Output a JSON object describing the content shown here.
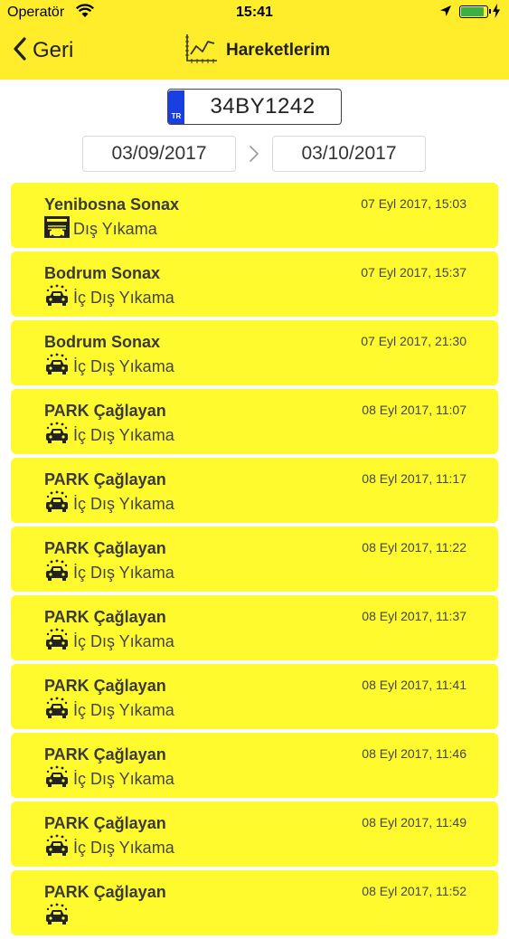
{
  "status_bar": {
    "carrier": "Operatör",
    "time": "15:41",
    "battery_level": 0.95,
    "battery_color": "#3cb043"
  },
  "nav": {
    "back_label": "Geri",
    "back_icon": "chevron-left-icon",
    "title": "Hareketlerim",
    "title_icon": "line-chart-icon",
    "bar_color": "#ffed2b"
  },
  "plate": {
    "country_code": "TR",
    "number": "34BY1242",
    "country_band_color": "#1a3fe0"
  },
  "date_range": {
    "start": "03/09/2017",
    "end": "03/10/2017",
    "separator_icon": "chevron-right-icon"
  },
  "transactions": [
    {
      "location": "Yenibosna Sonax",
      "date": "07 Eyl 2017, 15:03",
      "service": "Dış Yıkama",
      "icon": "car-wash-exterior-icon"
    },
    {
      "location": "Bodrum Sonax",
      "date": "07 Eyl 2017, 15:37",
      "service": "İç Dış Yıkama",
      "icon": "car-wash-full-icon"
    },
    {
      "location": "Bodrum Sonax",
      "date": "07 Eyl 2017, 21:30",
      "service": "İç Dış Yıkama",
      "icon": "car-wash-full-icon"
    },
    {
      "location": "PARK Çağlayan",
      "date": "08 Eyl 2017, 11:07",
      "service": "İç Dış Yıkama",
      "icon": "car-wash-full-icon"
    },
    {
      "location": "PARK Çağlayan",
      "date": "08 Eyl 2017, 11:17",
      "service": "İç Dış Yıkama",
      "icon": "car-wash-full-icon"
    },
    {
      "location": "PARK Çağlayan",
      "date": "08 Eyl 2017, 11:22",
      "service": "İç Dış Yıkama",
      "icon": "car-wash-full-icon"
    },
    {
      "location": "PARK Çağlayan",
      "date": "08 Eyl 2017, 11:37",
      "service": "İç Dış Yıkama",
      "icon": "car-wash-full-icon"
    },
    {
      "location": "PARK Çağlayan",
      "date": "08 Eyl 2017, 11:41",
      "service": "İç Dış Yıkama",
      "icon": "car-wash-full-icon"
    },
    {
      "location": "PARK Çağlayan",
      "date": "08 Eyl 2017, 11:46",
      "service": "İç Dış Yıkama",
      "icon": "car-wash-full-icon"
    },
    {
      "location": "PARK Çağlayan",
      "date": "08 Eyl 2017, 11:49",
      "service": "İç Dış Yıkama",
      "icon": "car-wash-full-icon"
    },
    {
      "location": "PARK Çağlayan",
      "date": "08 Eyl 2017, 11:52",
      "service": "",
      "icon": "car-wash-full-icon"
    }
  ],
  "colors": {
    "item_background": "#fffa2d"
  }
}
